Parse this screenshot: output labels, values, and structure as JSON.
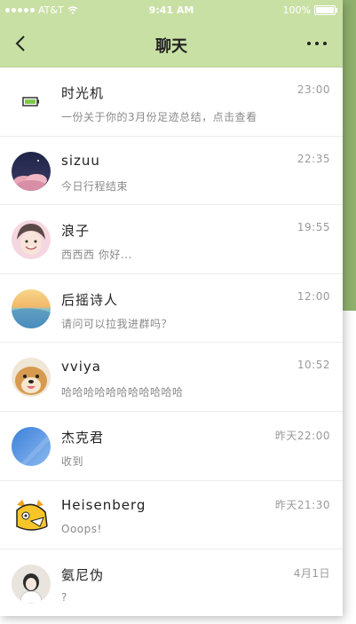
{
  "status_bar": {
    "carrier": "AT&T",
    "time": "9:41 AM",
    "battery": "100%"
  },
  "nav": {
    "title": "聊天"
  },
  "conversations": [
    {
      "name": "时光机",
      "message": "一份关于你的3月份足迹总结，点击查看",
      "time": "23:00",
      "avatar": "battery-icon"
    },
    {
      "name": "sizuu",
      "message": "今日行程结束",
      "time": "22:35",
      "avatar": "night-sky-avatar"
    },
    {
      "name": "浪子",
      "message": "西西西 你好...",
      "time": "19:55",
      "avatar": "anime-boy-avatar"
    },
    {
      "name": "后摇诗人",
      "message": "请问可以拉我进群吗？",
      "time": "12:00",
      "avatar": "sunset-avatar"
    },
    {
      "name": "vviya",
      "message": "哈哈哈哈哈哈哈哈哈哈哈",
      "time": "10:52",
      "avatar": "dog-avatar"
    },
    {
      "name": "杰克君",
      "message": "收到",
      "time": "昨天22:00",
      "avatar": "blue-sky-avatar"
    },
    {
      "name": "Heisenberg",
      "message": "Ooops!",
      "time": "昨天21:30",
      "avatar": "cartoon-avatar"
    },
    {
      "name": "氨尼伪",
      "message": "?",
      "time": "4月1日",
      "avatar": "girl-avatar"
    }
  ]
}
